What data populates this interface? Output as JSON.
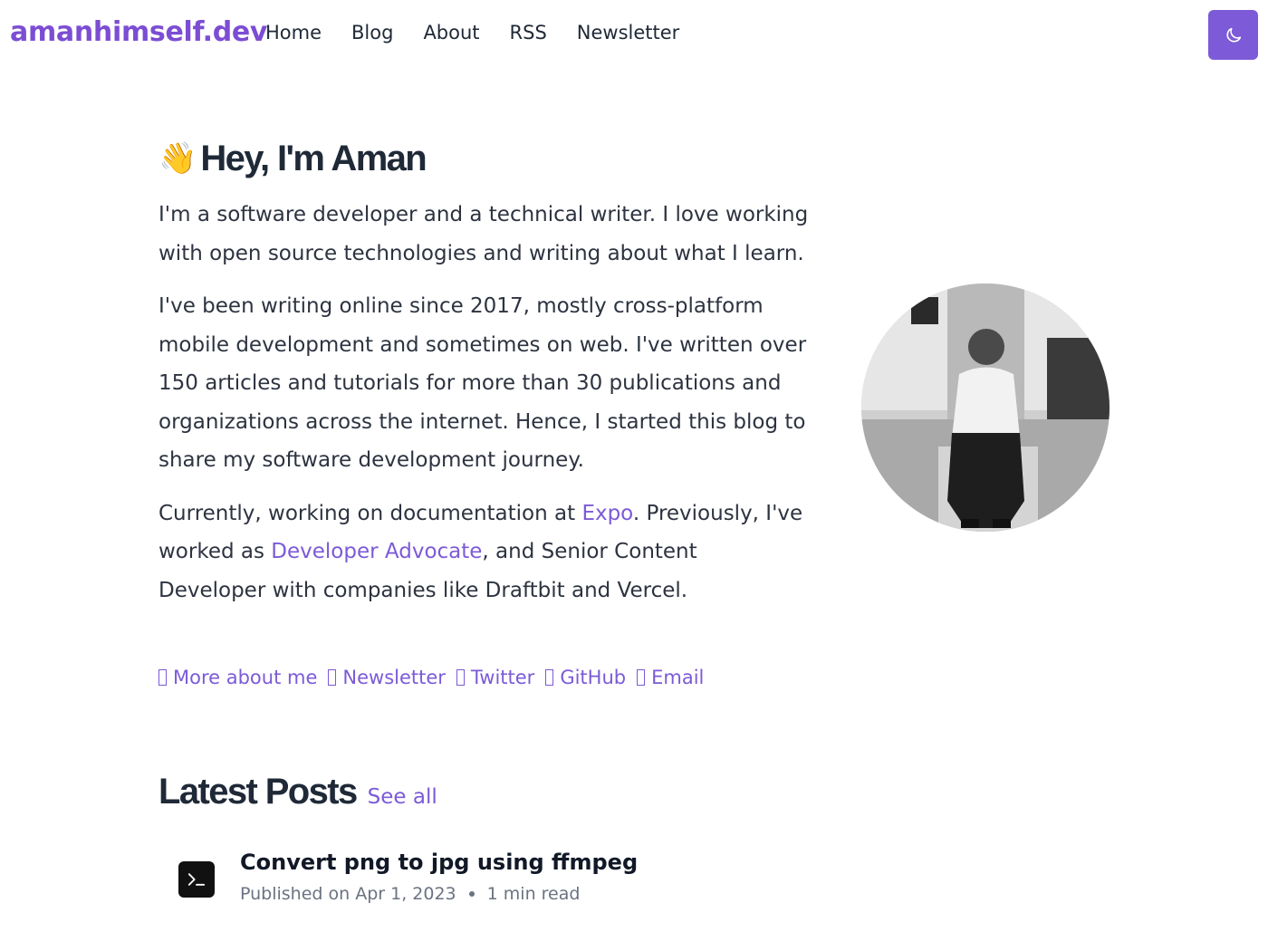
{
  "header": {
    "logo": "amanhimself.dev",
    "nav": [
      "Home",
      "Blog",
      "About",
      "RSS",
      "Newsletter"
    ],
    "theme_toggle_icon": "moon-icon"
  },
  "hero": {
    "emoji": "👋",
    "title": "Hey, I'm Aman",
    "para1": "I'm a software developer and a technical writer. I love working with open source technologies and writing about what I learn.",
    "para2": "I've been writing online since 2017, mostly cross-platform mobile development and sometimes on web. I've written over 150 articles and tutorials for more than 30 publications and organizations across the internet. Hence, I started this blog to share my software development journey.",
    "para3": {
      "t1": "Currently, working on documentation at ",
      "link1": "Expo",
      "t2": ". Previously, I've worked as ",
      "link2": "Developer Advocate",
      "t3": ", and Senior Content Developer with companies like Draftbit and Vercel."
    }
  },
  "social": [
    {
      "label": "More about me",
      "icon": "user-icon"
    },
    {
      "label": "Newsletter",
      "icon": "mail-icon"
    },
    {
      "label": "Twitter",
      "icon": "twitter-icon"
    },
    {
      "label": "GitHub",
      "icon": "github-icon"
    },
    {
      "label": "Email",
      "icon": "email-icon"
    }
  ],
  "latest": {
    "title": "Latest Posts",
    "see_all": "See all",
    "posts": [
      {
        "title": "Convert png to jpg using ffmpeg",
        "published": "Published on Apr 1, 2023",
        "read_time": "1 min read",
        "icon": "terminal-icon"
      }
    ]
  },
  "colors": {
    "accent": "#7c5ad8",
    "logo": "#7c4dd4",
    "text": "#1f2937"
  }
}
